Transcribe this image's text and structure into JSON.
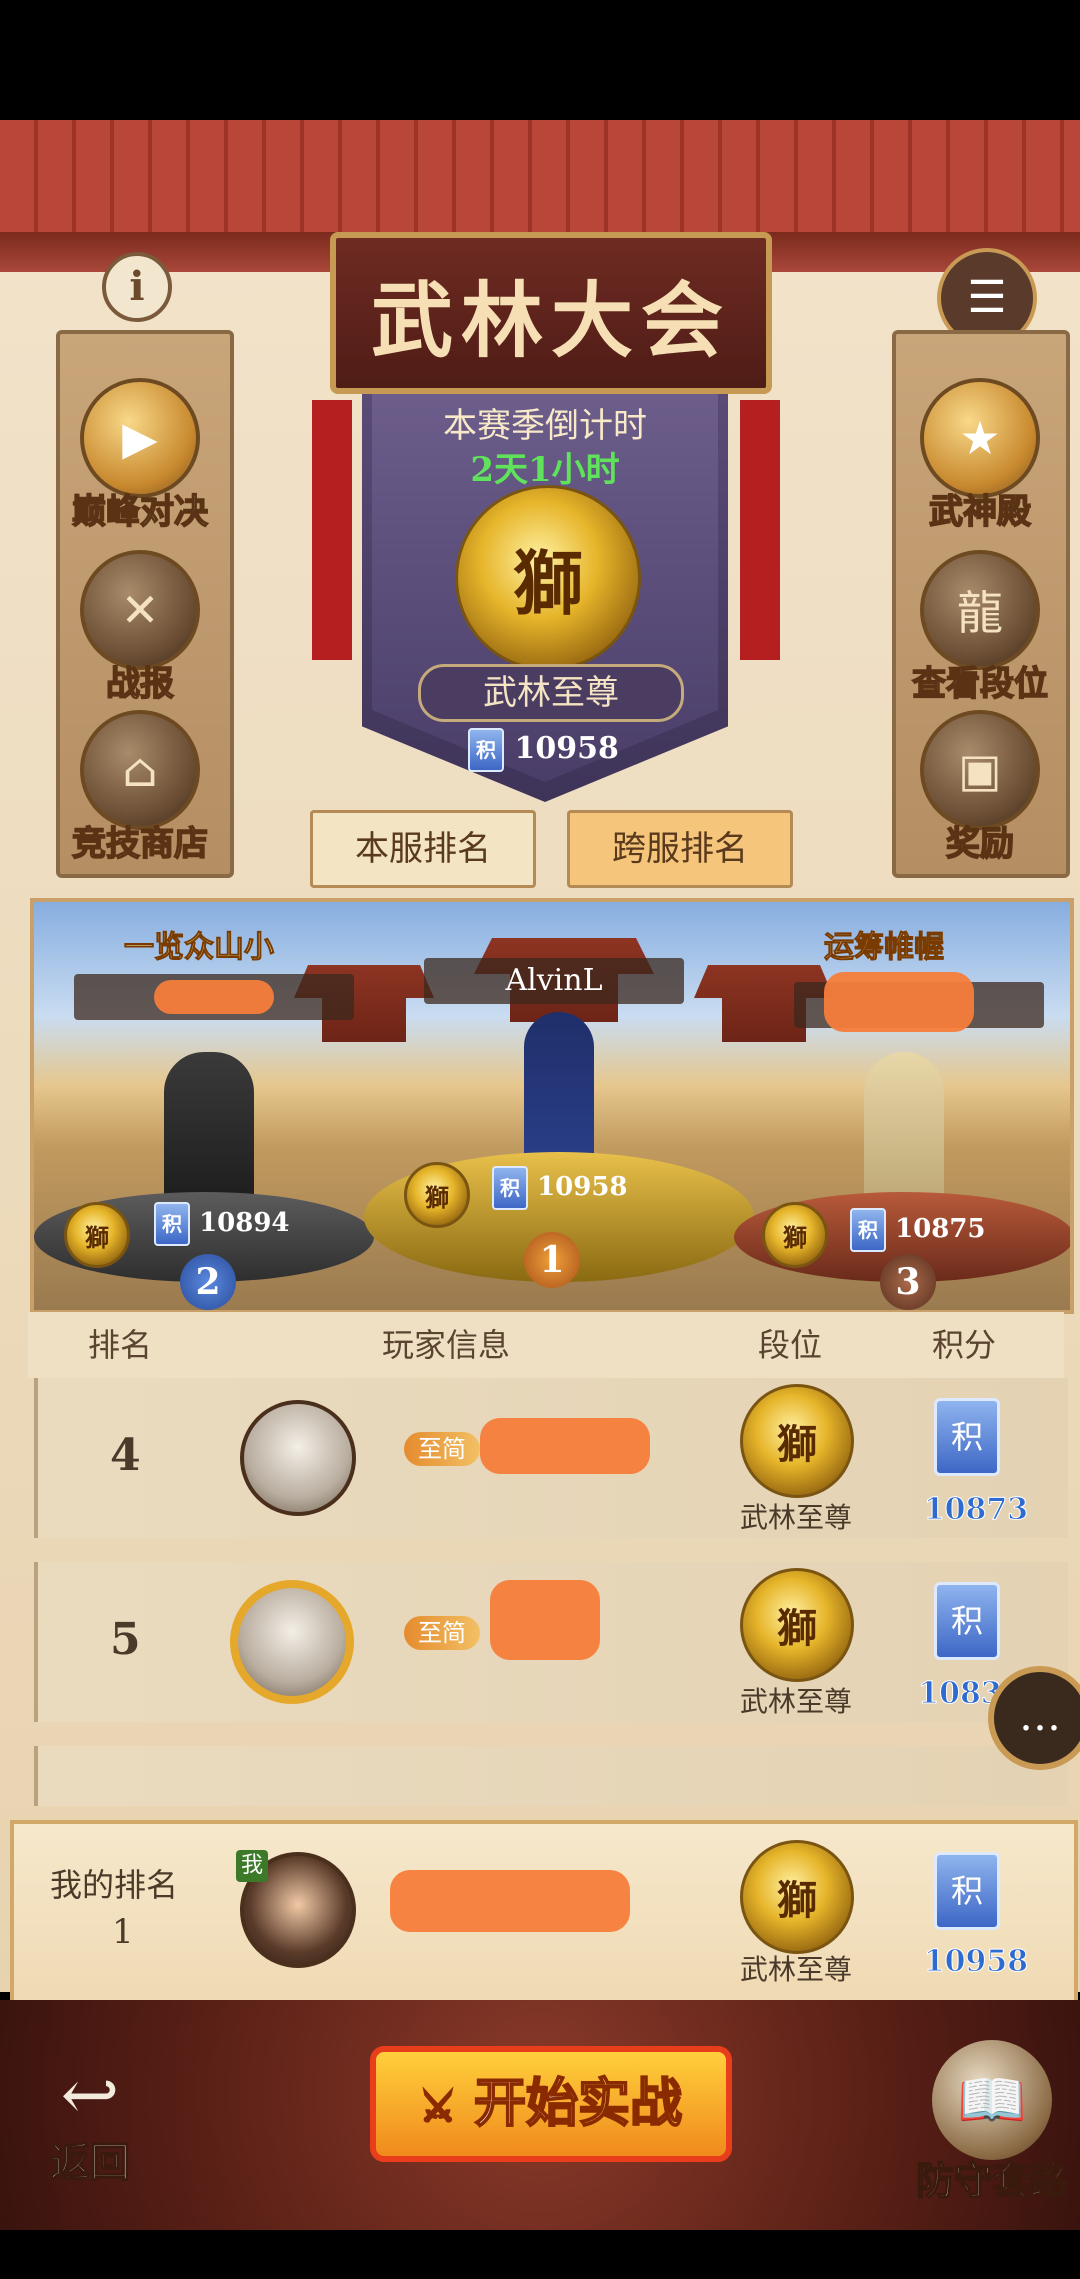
{
  "header": {
    "title": "武林大会",
    "info_icon": "i",
    "cross_server_label": "跨服"
  },
  "left_menu": [
    {
      "label": "巅峰对决",
      "icon": "play-icon"
    },
    {
      "label": "战报",
      "icon": "crossed-swords-icon"
    },
    {
      "label": "竞技商店",
      "icon": "shop-icon"
    }
  ],
  "right_menu": [
    {
      "label": "武神殿",
      "icon": "hall-icon"
    },
    {
      "label": "查看段位",
      "icon": "dragon-icon"
    },
    {
      "label": "奖励",
      "icon": "chest-icon"
    }
  ],
  "season": {
    "countdown_label": "本赛季倒计时",
    "countdown_value": "2天1小时",
    "rank_name": "武林至尊",
    "score_icon": "积",
    "score": "10958"
  },
  "tabs": [
    {
      "label": "本服排名",
      "active": false
    },
    {
      "label": "跨服排名",
      "active": true
    }
  ],
  "podium": {
    "first": {
      "name": "AlvinL",
      "score": "10958",
      "place": "1"
    },
    "second": {
      "title": "一览众山小",
      "score": "10894",
      "place": "2"
    },
    "third": {
      "title": "运筹帷幄",
      "score": "10875",
      "place": "3"
    }
  },
  "table": {
    "headers": [
      "排名",
      "玩家信息",
      "段位",
      "积分"
    ],
    "rows": [
      {
        "rank": "4",
        "vip": "至简",
        "tier": "武林至尊",
        "points_icon": "积",
        "points": "10873"
      },
      {
        "rank": "5",
        "vip": "至简",
        "tier": "武林至尊",
        "points_icon": "积",
        "points": "1083"
      }
    ]
  },
  "my_rank": {
    "label": "我的排名",
    "value": "1",
    "badge": "我",
    "tier": "武林至尊",
    "points_icon": "积",
    "points": "10958"
  },
  "bottom": {
    "back_label": "返回",
    "start_label_a": "开始",
    "start_label_b": "实战",
    "defense_label": "防守套路"
  },
  "colors": {
    "accent_gold": "#e6b52a",
    "points_blue": "#2e6bd0",
    "countdown_green": "#5fe35a",
    "redaction": "#f57d3a"
  }
}
